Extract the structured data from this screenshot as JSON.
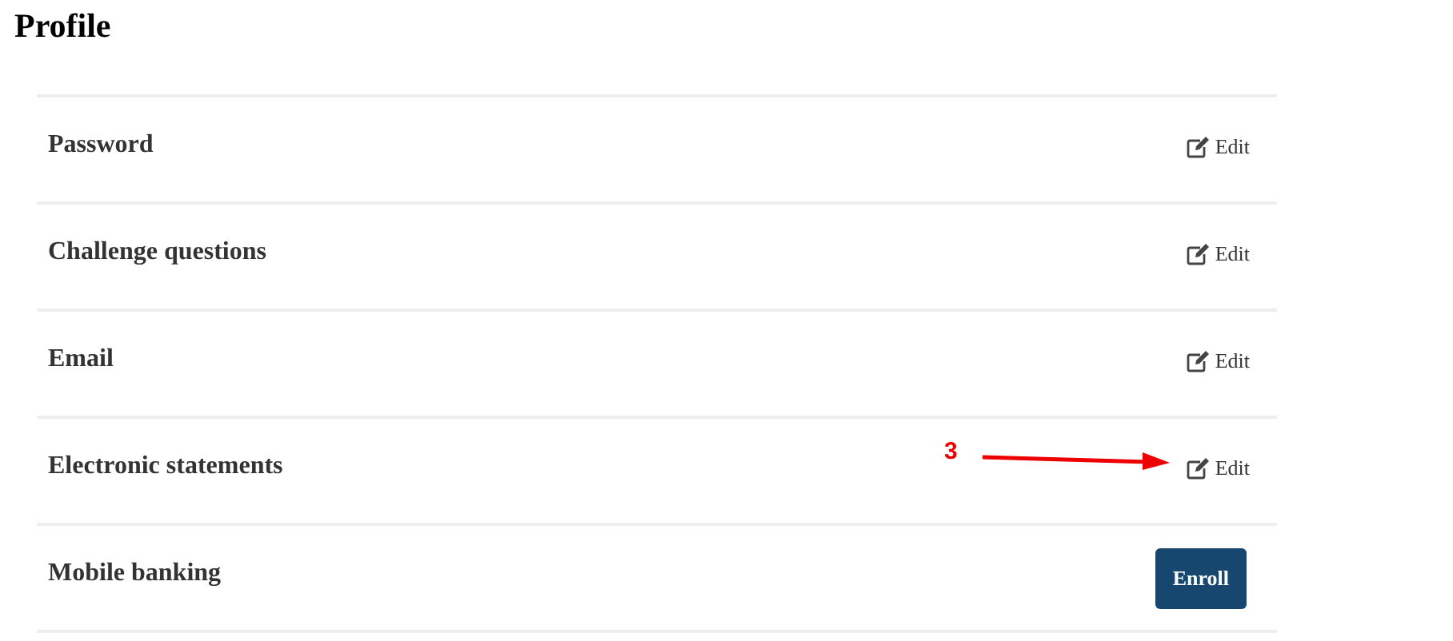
{
  "title": "Profile",
  "rows": [
    {
      "label": "Password",
      "kind": "edit",
      "action": "Edit"
    },
    {
      "label": "Challenge questions",
      "kind": "edit",
      "action": "Edit"
    },
    {
      "label": "Email",
      "kind": "edit",
      "action": "Edit"
    },
    {
      "label": "Electronic statements",
      "kind": "edit",
      "action": "Edit",
      "annotation": "3"
    },
    {
      "label": "Mobile banking",
      "kind": "enroll",
      "action": "Enroll"
    }
  ]
}
